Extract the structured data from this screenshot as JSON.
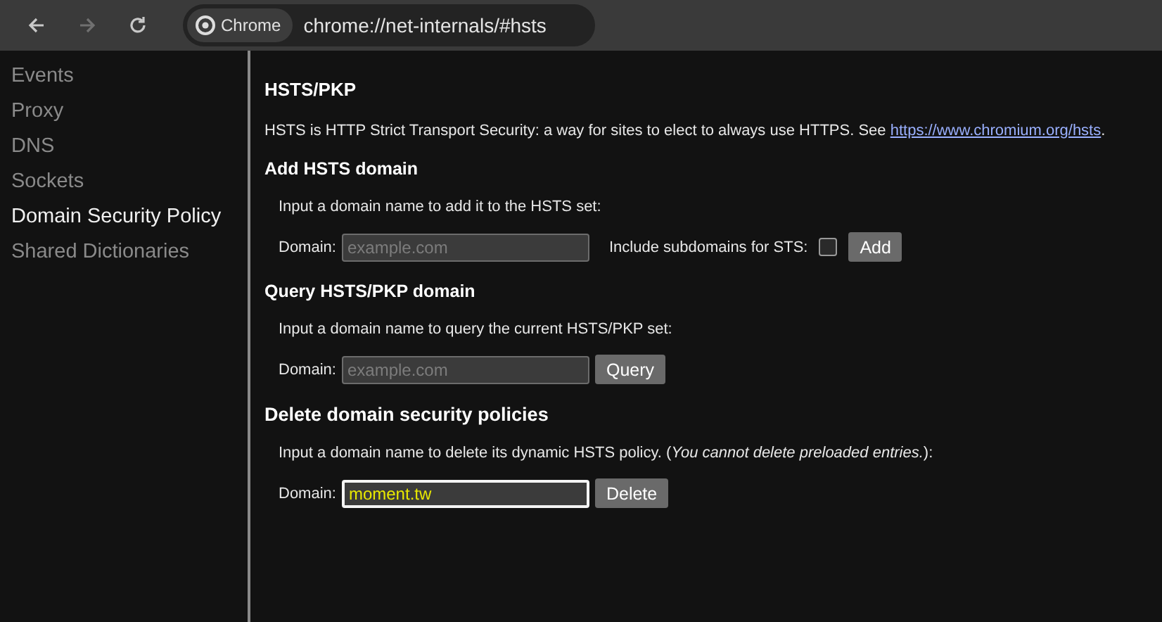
{
  "toolbar": {
    "nav_buttons": [
      {
        "kind": "back",
        "disabled": false
      },
      {
        "kind": "forward",
        "disabled": true
      },
      {
        "kind": "reload",
        "disabled": false
      }
    ],
    "chip_label": "Chrome",
    "url": "chrome://net-internals/#hsts"
  },
  "sidebar": {
    "items": [
      {
        "label": "Events",
        "selected": false
      },
      {
        "label": "Proxy",
        "selected": false
      },
      {
        "label": "DNS",
        "selected": false
      },
      {
        "label": "Sockets",
        "selected": false
      },
      {
        "label": "Domain Security Policy",
        "selected": true
      },
      {
        "label": "Shared Dictionaries",
        "selected": false
      }
    ]
  },
  "main": {
    "title": "HSTS/PKP",
    "intro": {
      "text": "HSTS is HTTP Strict Transport Security: a way for sites to elect to always use HTTPS. See ",
      "link": "https://www.chromium.org/hsts",
      "suffix": "."
    },
    "sections": [
      {
        "kind": "subsection",
        "title": "Add HSTS domain",
        "description": "Input a domain name to add it to the HSTS set:",
        "form": {
          "label": "Domain:",
          "placeholder": "example.com",
          "focused": false,
          "checkbox": {
            "label": "Include subdomains for STS:",
            "checked": false
          },
          "button": "Add"
        }
      },
      {
        "kind": "subsection",
        "title": "Query HSTS/PKP domain",
        "description": "Input a domain name to query the current HSTS/PKP set:",
        "form": {
          "label": "Domain:",
          "placeholder": "example.com",
          "focused": false,
          "button": "Query"
        }
      },
      {
        "kind": "section",
        "title": "Delete domain security policies",
        "description": "Input a domain name to delete its dynamic HSTS policy. (*You cannot delete preloaded entries.*):",
        "form": {
          "label": "Domain:",
          "value": "moment.tw",
          "focused": true,
          "button": "Delete"
        }
      }
    ]
  }
}
